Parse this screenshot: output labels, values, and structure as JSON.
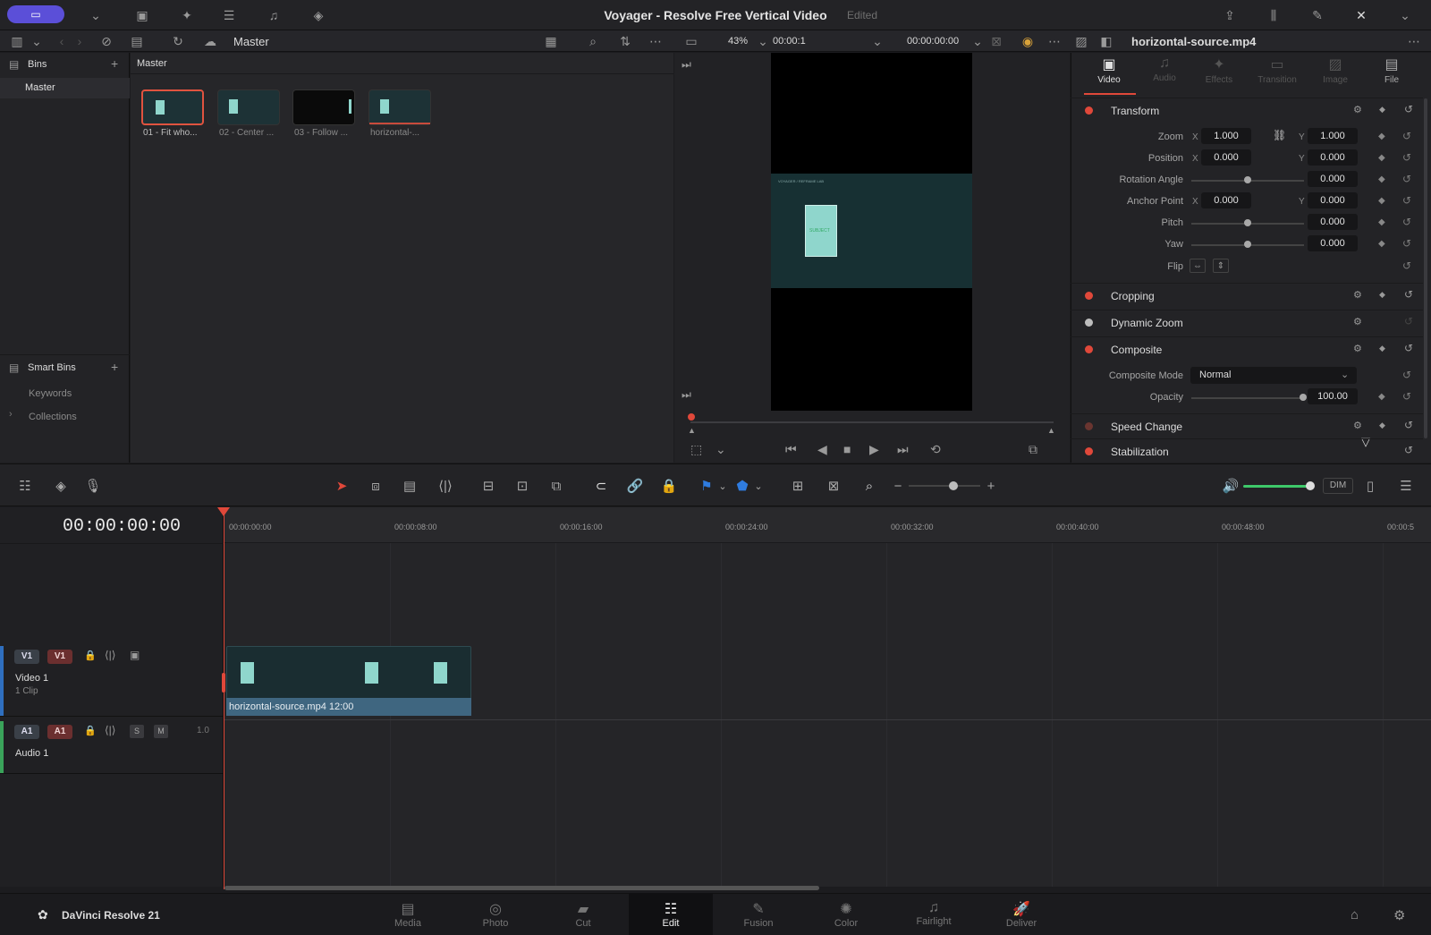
{
  "titlebar": {
    "title": "Voyager - Resolve Free Vertical Video",
    "status": "Edited"
  },
  "subbar": {
    "pool_name": "Master",
    "zoom": "43%",
    "timecode_short": "00:00:1",
    "timecode_long": "00:00:00:00",
    "clip_name": "horizontal-source.mp4"
  },
  "bins": {
    "header": "Bins",
    "master": "Master",
    "smart_bins": "Smart Bins",
    "keywords": "Keywords",
    "collections": "Collections"
  },
  "mediapool": {
    "header": "Master",
    "clips": [
      "01 - Fit who...",
      "02 - Center ...",
      "03 - Follow ...",
      "horizontal-..."
    ]
  },
  "viewer": {
    "frame_caption": "VOYAGER / REFRAME LAB",
    "subject_label": "SUBJECT"
  },
  "inspector": {
    "tabs": [
      "Video",
      "Audio",
      "Effects",
      "Transition",
      "Image",
      "File"
    ],
    "transform": {
      "title": "Transform",
      "zoom_label": "Zoom",
      "zoom_x": "1.000",
      "zoom_y": "1.000",
      "position_label": "Position",
      "position_x": "0.000",
      "position_y": "0.000",
      "rotation_label": "Rotation Angle",
      "rotation": "0.000",
      "anchor_label": "Anchor Point",
      "anchor_x": "0.000",
      "anchor_y": "0.000",
      "pitch_label": "Pitch",
      "pitch": "0.000",
      "yaw_label": "Yaw",
      "yaw": "0.000",
      "flip_label": "Flip",
      "axis_x": "X",
      "axis_y": "Y"
    },
    "cropping": "Cropping",
    "dynamic_zoom": "Dynamic Zoom",
    "composite": {
      "title": "Composite",
      "mode_label": "Composite Mode",
      "mode_value": "Normal",
      "opacity_label": "Opacity",
      "opacity_value": "100.00"
    },
    "speed_change": "Speed Change",
    "stabilization": "Stabilization"
  },
  "timeline": {
    "timecode": "00:00:00:00",
    "ruler": [
      "00:00:00:00",
      "00:00:08:00",
      "00:00:16:00",
      "00:00:24:00",
      "00:00:32:00",
      "00:00:40:00",
      "00:00:48:00",
      "00:00:5"
    ],
    "dim_label": "DIM",
    "video_track": {
      "badge1": "V1",
      "badge2": "V1",
      "name": "Video 1",
      "clips": "1 Clip"
    },
    "audio_track": {
      "badge1": "A1",
      "badge2": "A1",
      "name": "Audio 1",
      "s": "S",
      "m": "M",
      "level": "1.0"
    },
    "clip_label": "horizontal-source.mp4  12:00"
  },
  "pagebar": {
    "brand": "DaVinci Resolve 21",
    "pages": [
      "Media",
      "Photo",
      "Cut",
      "Edit",
      "Fusion",
      "Color",
      "Fairlight",
      "Deliver"
    ],
    "active_page": "Edit"
  }
}
